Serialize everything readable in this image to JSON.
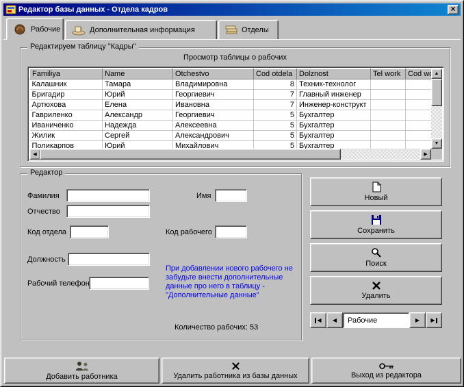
{
  "window": {
    "title": "Редактор базы данных - Отдела кадров",
    "close_label": "×"
  },
  "tabs": [
    {
      "label": "Рабочие"
    },
    {
      "label": "Дополнительная информация"
    },
    {
      "label": "Отделы"
    }
  ],
  "table_group": {
    "title": "Редактируем таблицу \"Кадры\"",
    "caption": "Просмотр таблицы о рабочих",
    "columns": [
      "Familiya",
      "Name",
      "Otchestvo",
      "Cod otdela",
      "Dolznost",
      "Tel work",
      "Cod wor"
    ],
    "rows": [
      [
        "Калашник",
        "Тамара",
        "Владимировна",
        "8",
        "Техник-технолог",
        "",
        ""
      ],
      [
        "Бригадир",
        "Юрий",
        "Георгиевич",
        "7",
        "Главный инженер",
        "",
        ""
      ],
      [
        "Артюхова",
        "Елена",
        "Ивановна",
        "7",
        "Инженер-конструкт",
        "",
        ""
      ],
      [
        "Гавриленко",
        "Александр",
        "Георгиевич",
        "5",
        "Бухгалтер",
        "",
        ""
      ],
      [
        "Иваниченко",
        "Надежда",
        "Алексеевна",
        "5",
        "Бухгалтер",
        "",
        ""
      ],
      [
        "Жилик",
        "Сергей",
        "Александрович",
        "5",
        "Бухгалтер",
        "",
        ""
      ],
      [
        "Поликарпов",
        "Юрий",
        "Михайлович",
        "5",
        "Бухгалтер",
        "",
        ""
      ]
    ]
  },
  "editor": {
    "title": "Редактор",
    "fields": {
      "surname_label": "Фамилия",
      "firstname_label": "Имя",
      "patronymic_label": "Отчество",
      "dept_code_label": "Код отдела",
      "worker_code_label": "Код рабочего",
      "position_label": "Должность",
      "phone_label": "Рабочий телефон"
    },
    "note": "При добавлении нового рабочего не забудьте внести дополнительные данные про него в таблицу - \"Дополнительные данные\"",
    "count_label": "Количество рабочих:",
    "count_value": "53"
  },
  "actions": {
    "new": "Новый",
    "save": "Сохранить",
    "search": "Поиск",
    "delete": "Удалить"
  },
  "navigator": {
    "label": "Рабочие",
    "first": "◀",
    "prev": "◀",
    "next": "▶",
    "last": "▶"
  },
  "icons": {
    "up": "▲",
    "down": "▼",
    "left": "◀",
    "right": "▶"
  },
  "bottom": {
    "add": "Добавить работника",
    "remove": "Удалить работника из базы данных",
    "exit": "Выход из редактора"
  }
}
